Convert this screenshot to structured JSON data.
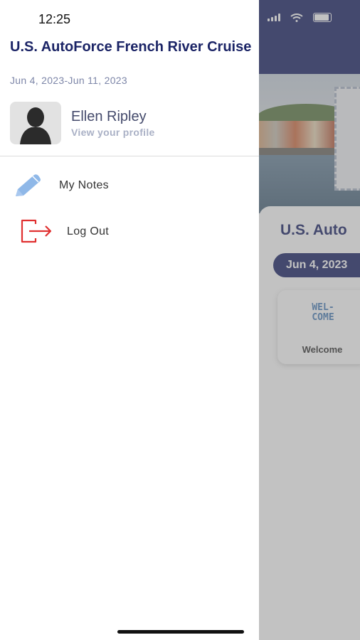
{
  "status_bar": {
    "time": "12:25"
  },
  "drawer": {
    "trip_title": "U.S. AutoForce French River Cruise",
    "trip_dates": "Jun 4, 2023-Jun 11, 2023",
    "profile": {
      "name": "Ellen Ripley",
      "link_label": "View your profile",
      "avatar_icon": "person-silhouette-icon"
    },
    "menu": [
      {
        "label": "My Notes",
        "icon": "pencil-icon",
        "icon_color": "#8fb8e8"
      },
      {
        "label": "Log Out",
        "icon": "logout-icon",
        "icon_color": "#e03030"
      }
    ]
  },
  "background": {
    "card_title": "U.S. Auto",
    "date_pill": "Jun 4, 2023",
    "tile_label": "Welcome",
    "tile_art_text": "WEL-\nCOME"
  },
  "colors": {
    "brand_navy": "#1b2466",
    "muted_text": "#7d86a8",
    "logout_red": "#e03030",
    "pencil_blue": "#8fb8e8"
  }
}
